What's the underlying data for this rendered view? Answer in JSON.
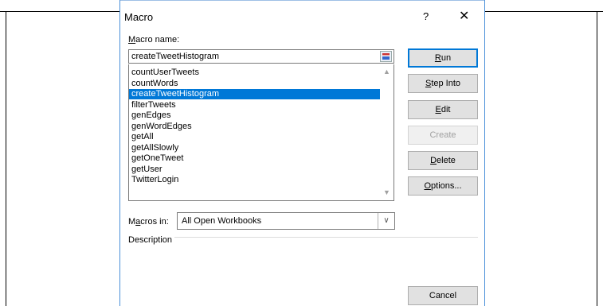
{
  "dialog": {
    "title": "Macro",
    "help": "?",
    "close": "✕",
    "macro_name_label": {
      "access": "M",
      "rest": "acro name:"
    },
    "macro_name_value": "createTweetHistogram",
    "macros": [
      "countUserTweets",
      "countWords",
      "createTweetHistogram",
      "filterTweets",
      "genEdges",
      "genWordEdges",
      "getAll",
      "getAllSlowly",
      "getOneTweet",
      "getUser",
      "TwitterLogin"
    ],
    "selected_index": 2,
    "macros_in_label": {
      "pre": "M",
      "access": "a",
      "rest": "cros in:"
    },
    "macros_in_value": "All Open Workbooks",
    "description_label": "Description"
  },
  "buttons": {
    "run": {
      "access": "R",
      "rest": "un"
    },
    "step_into": {
      "access": "S",
      "rest": "tep Into"
    },
    "edit": {
      "access": "E",
      "rest": "dit"
    },
    "create": "Create",
    "delete": {
      "access": "D",
      "rest": "elete"
    },
    "options": {
      "access": "O",
      "rest": "ptions..."
    },
    "cancel": "Cancel"
  },
  "colors": {
    "selection": "#0078d7",
    "default_button_border": "#0078d7"
  }
}
